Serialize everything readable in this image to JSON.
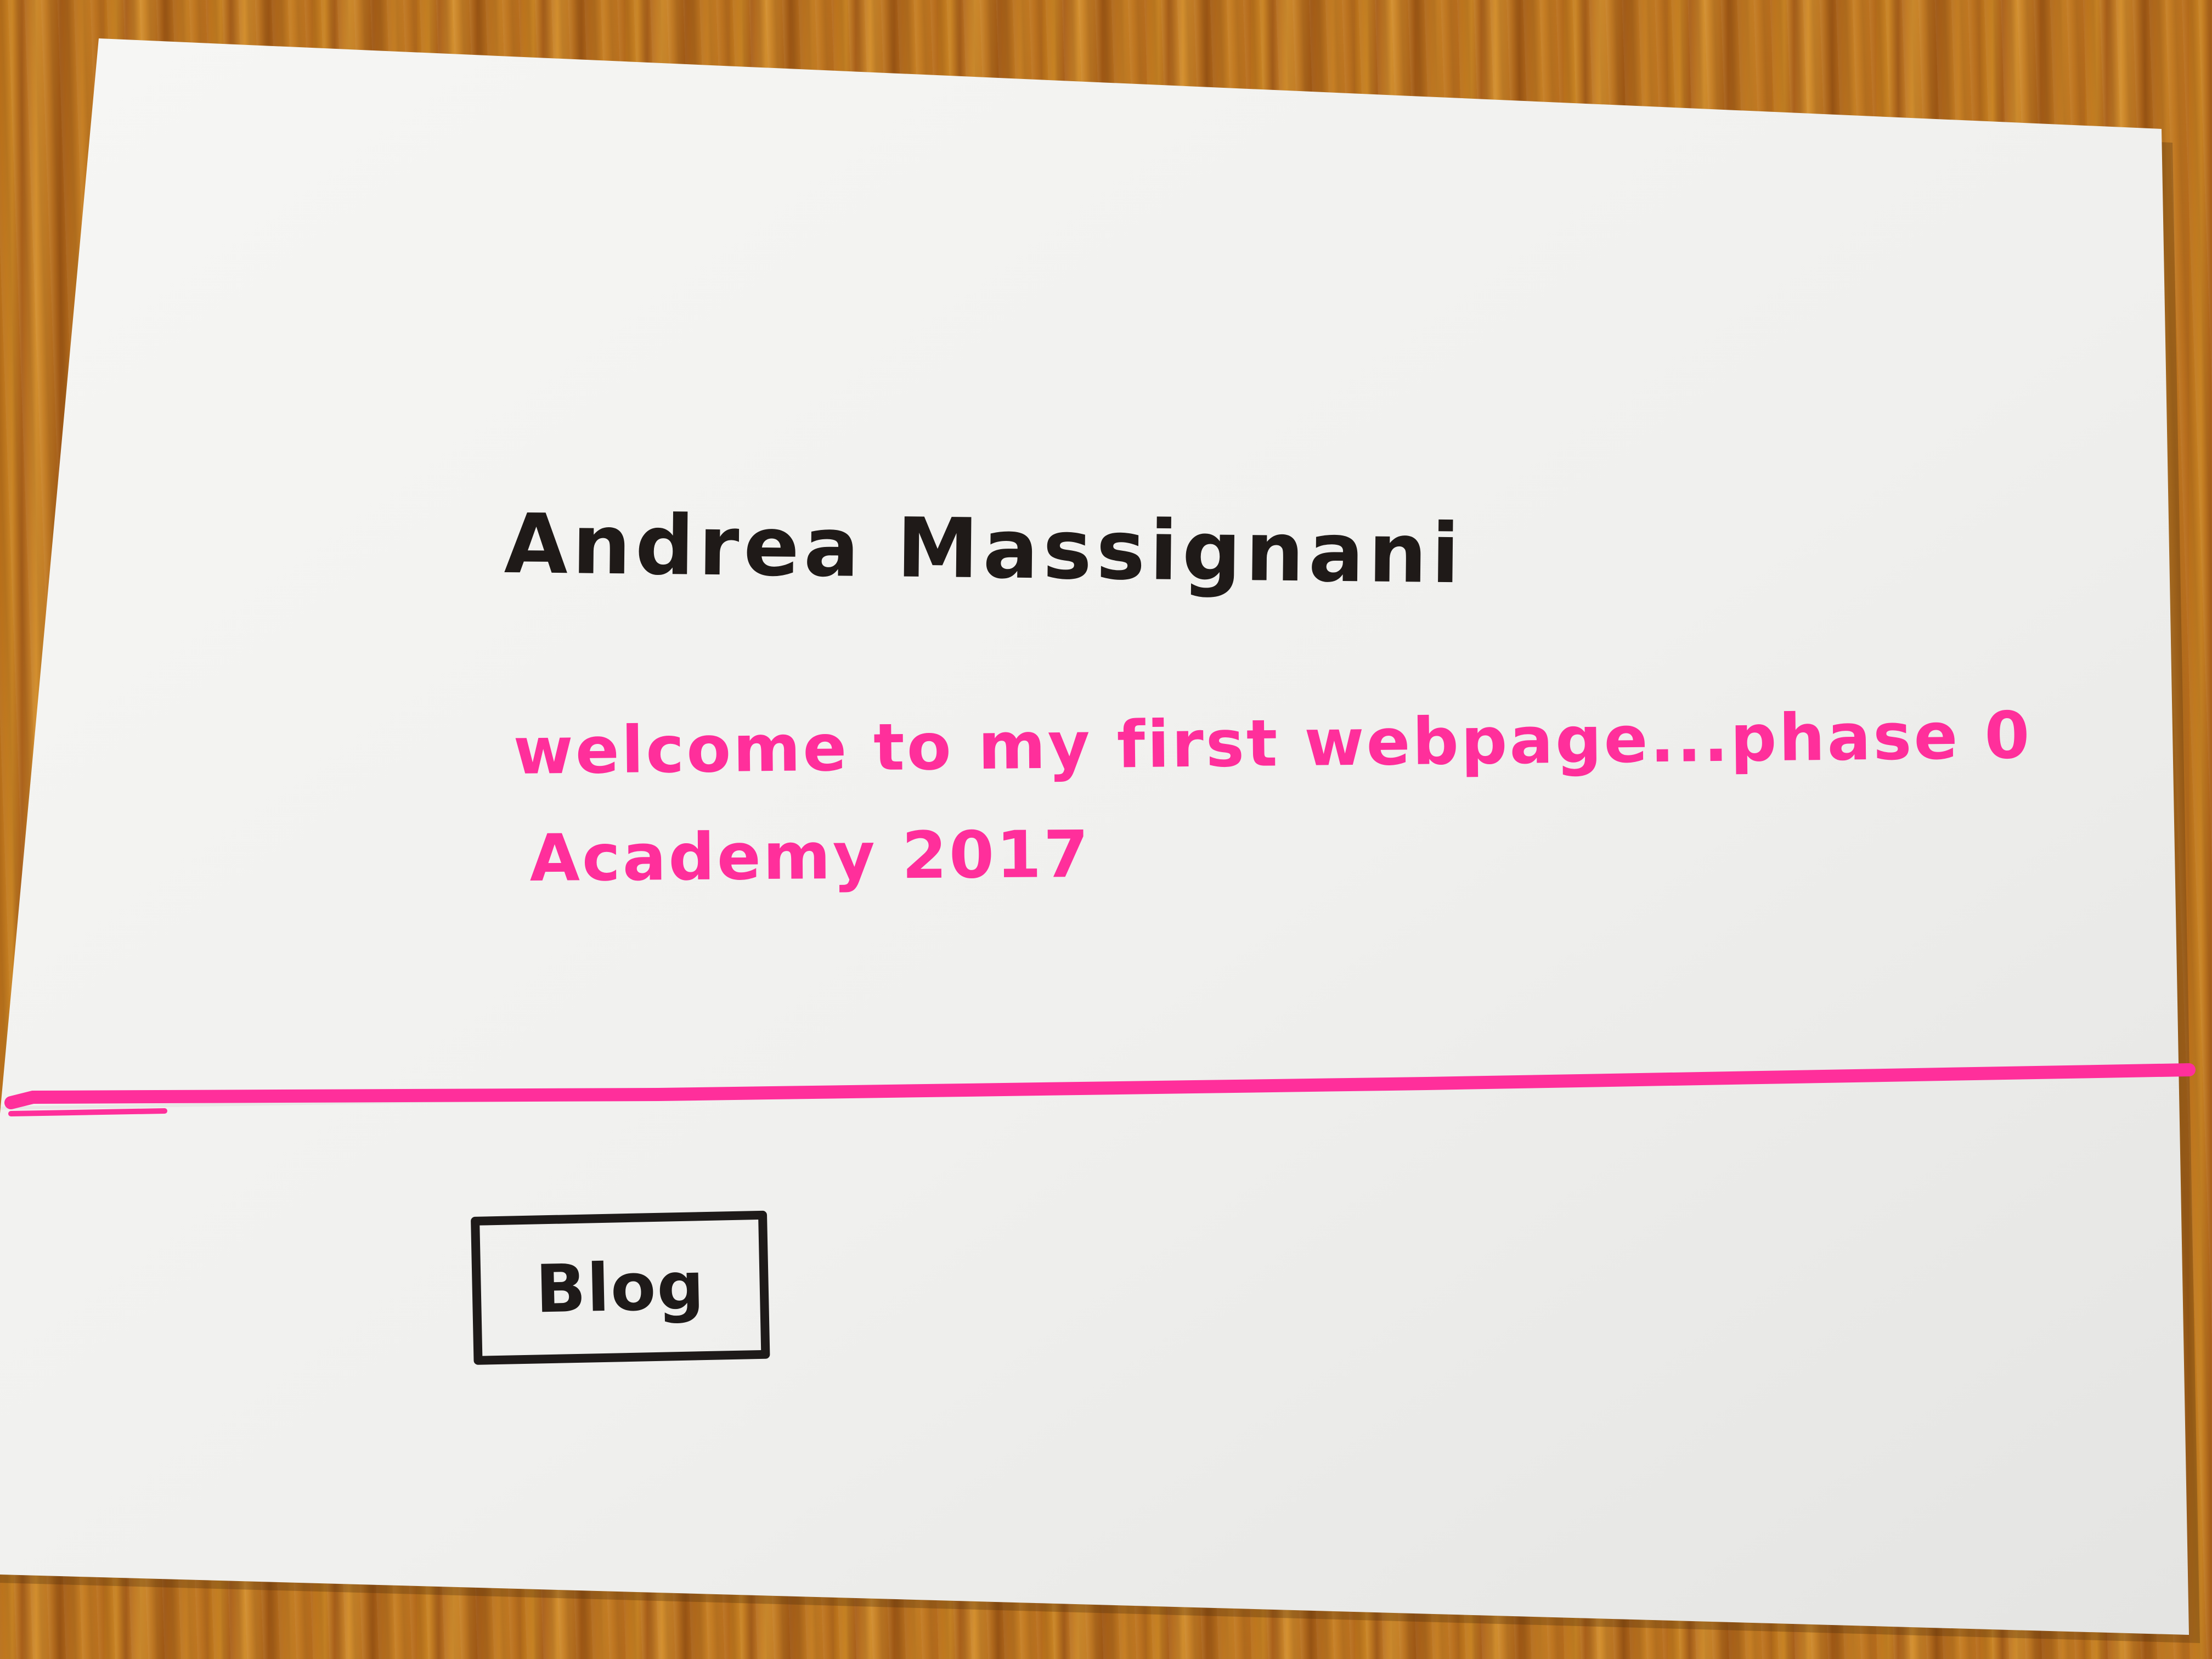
{
  "header": {
    "title": "Andrea Massignani"
  },
  "hero": {
    "welcome_text": "welcome to my first webpage...phase 0",
    "signature_text": "Academy 2017"
  },
  "navigation": {
    "blog_label": "Blog"
  },
  "colors": {
    "ink_black": "#1f1a18",
    "accent_pink": "#ff2f9b",
    "paper": "#f2f2f0",
    "desk_wood": "#c27b22"
  }
}
